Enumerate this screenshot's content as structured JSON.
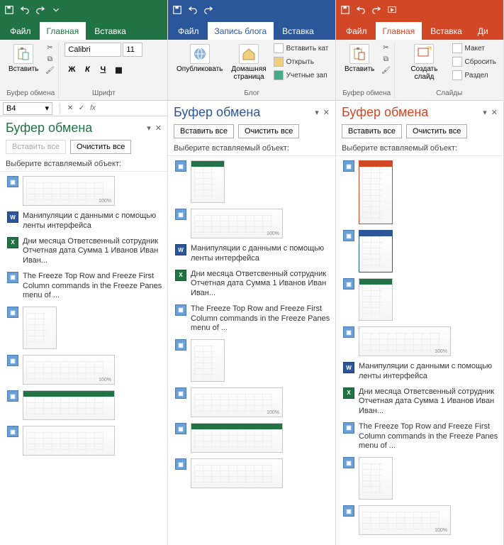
{
  "qat_icons": {
    "save": "save-icon",
    "undo": "undo-icon",
    "redo": "redo-icon",
    "touch": "touch-icon"
  },
  "excel": {
    "tabs": [
      {
        "label": "Файл",
        "active": false
      },
      {
        "label": "Главная",
        "active": true
      },
      {
        "label": "Вставка",
        "active": false
      }
    ],
    "paste": "Вставить",
    "clipboard_group": "Буфер обмена",
    "font_group": "Шрифт",
    "font_name": "Calibri",
    "font_size": "11",
    "bold": "Ж",
    "italic": "К",
    "underline": "Ч",
    "cell_ref": "B4"
  },
  "word": {
    "tabs": [
      {
        "label": "Файл",
        "active": false
      },
      {
        "label": "Запись блога",
        "active": true
      },
      {
        "label": "Вставка",
        "active": false
      }
    ],
    "publish": "Опубликовать",
    "home_page": "Домашняя страница",
    "insert_cat": "Вставить кат",
    "open": "Открыть",
    "accounts": "Учетные зап",
    "blog_group": "Блог"
  },
  "ppt": {
    "tabs": [
      {
        "label": "Файл",
        "active": false
      },
      {
        "label": "Главная",
        "active": true
      },
      {
        "label": "Вставка",
        "active": false
      },
      {
        "label": "Ди",
        "active": false
      }
    ],
    "paste": "Вставить",
    "clipboard_group": "Буфер обмена",
    "new_slide": "Создать слайд",
    "layout": "Макет",
    "reset": "Сбросить",
    "section": "Раздел",
    "slides_group": "Слайды"
  },
  "pane": {
    "title": "Буфер обмена",
    "paste_all": "Вставить все",
    "clear_all": "Очистить все",
    "select_label": "Выберите вставляемый объект:"
  },
  "clips": {
    "text1": "Манипуляции с данными с помощью ленты интерфейса",
    "text2": "Дни месяца Ответсвенный сотрудник Отчетная дата Сумма 1 Иванов Иван Иван...",
    "text3": "The Freeze Top Row and Freeze First Column commands in the Freeze Panes menu of ...",
    "zoom": "100%"
  }
}
